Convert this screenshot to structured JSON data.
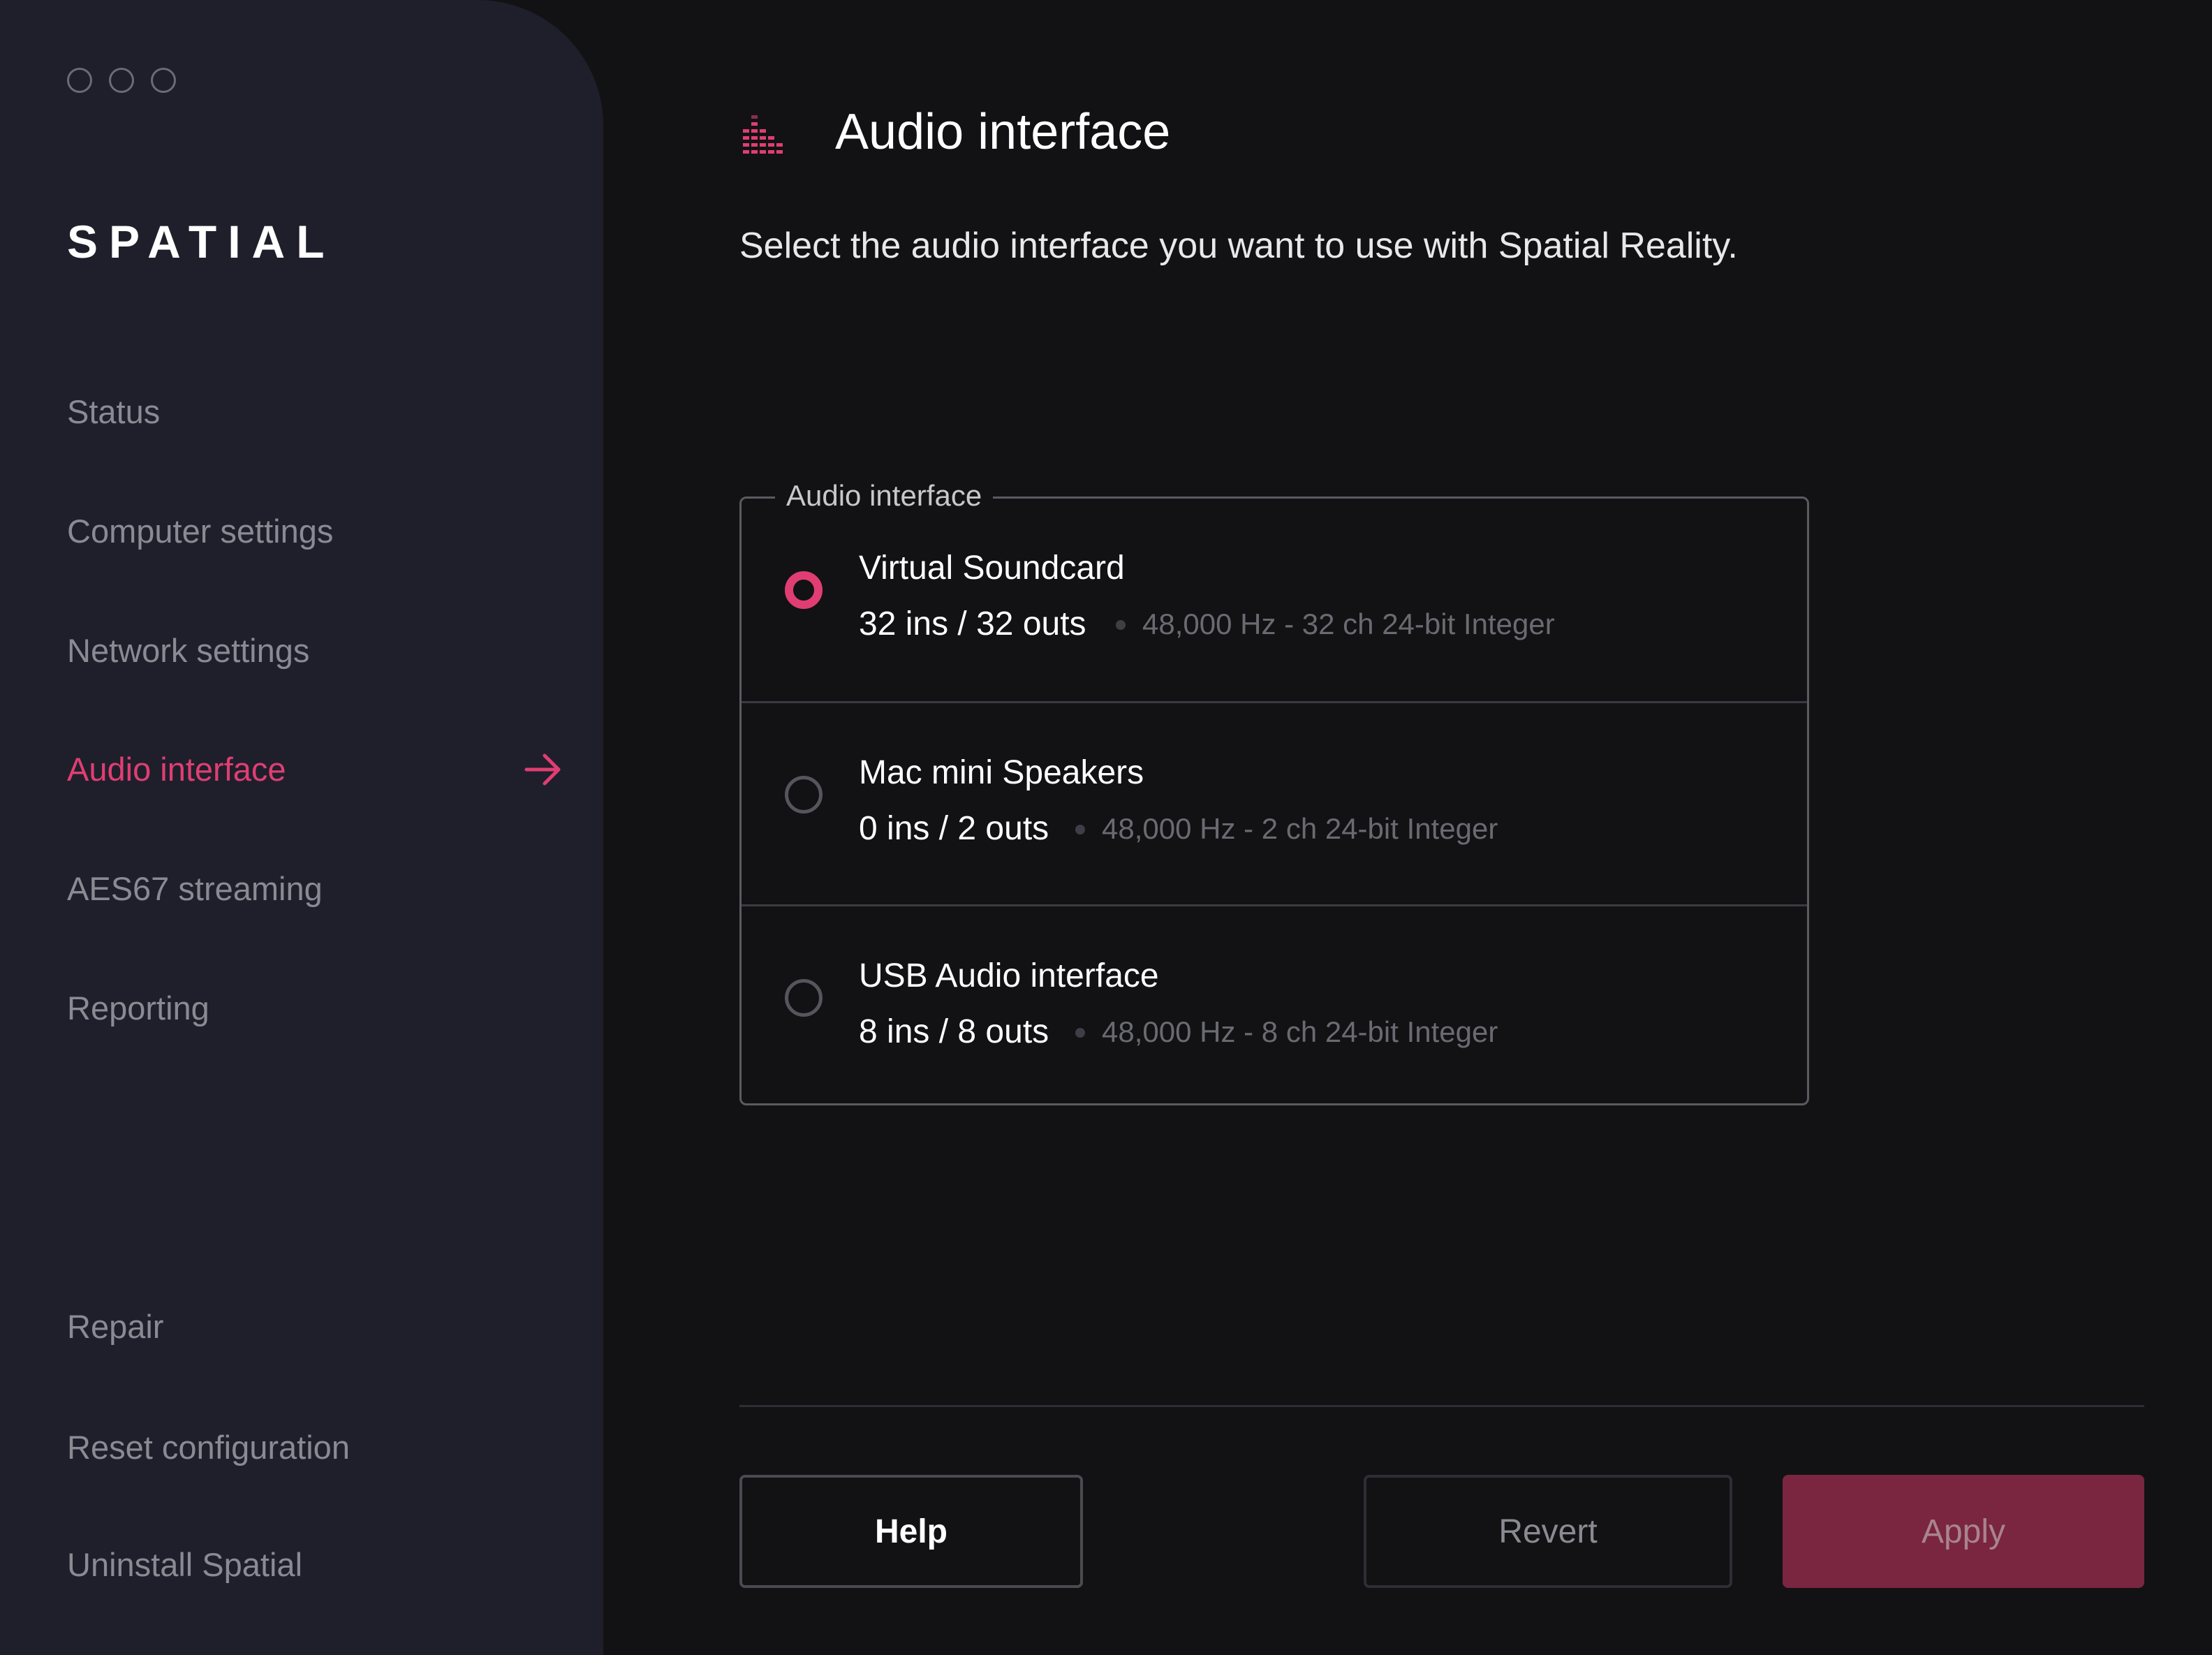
{
  "app": {
    "brand": "SPATIAL"
  },
  "sidebar": {
    "items": [
      {
        "label": "Status"
      },
      {
        "label": "Computer settings"
      },
      {
        "label": "Network settings"
      },
      {
        "label": "Audio interface",
        "active": true
      },
      {
        "label": "AES67 streaming"
      },
      {
        "label": "Reporting"
      }
    ],
    "footer_items": [
      {
        "label": "Repair"
      },
      {
        "label": "Reset configuration"
      },
      {
        "label": "Uninstall Spatial"
      }
    ]
  },
  "main": {
    "title": "Audio interface",
    "icon": "equalizer-icon",
    "subtitle": "Select the audio interface you want to use with Spatial Reality.",
    "group": {
      "legend": "Audio interface",
      "options": [
        {
          "name": "Virtual Soundcard",
          "io": "32 ins / 32 outs",
          "format": "48,000 Hz - 32 ch 24-bit Integer",
          "selected": true
        },
        {
          "name": "Mac mini Speakers",
          "io": "0 ins / 2 outs",
          "format": "48,000 Hz - 2 ch 24-bit Integer",
          "selected": false
        },
        {
          "name": "USB Audio interface",
          "io": "8 ins / 8 outs",
          "format": "48,000 Hz - 8 ch 24-bit Integer",
          "selected": false
        }
      ]
    }
  },
  "footer": {
    "help_label": "Help",
    "revert_label": "Revert",
    "apply_label": "Apply"
  },
  "colors": {
    "accent": "#e03e72",
    "sidebar_bg": "#1f1f2c",
    "main_bg": "#121214",
    "apply_bg": "#7a2640"
  }
}
